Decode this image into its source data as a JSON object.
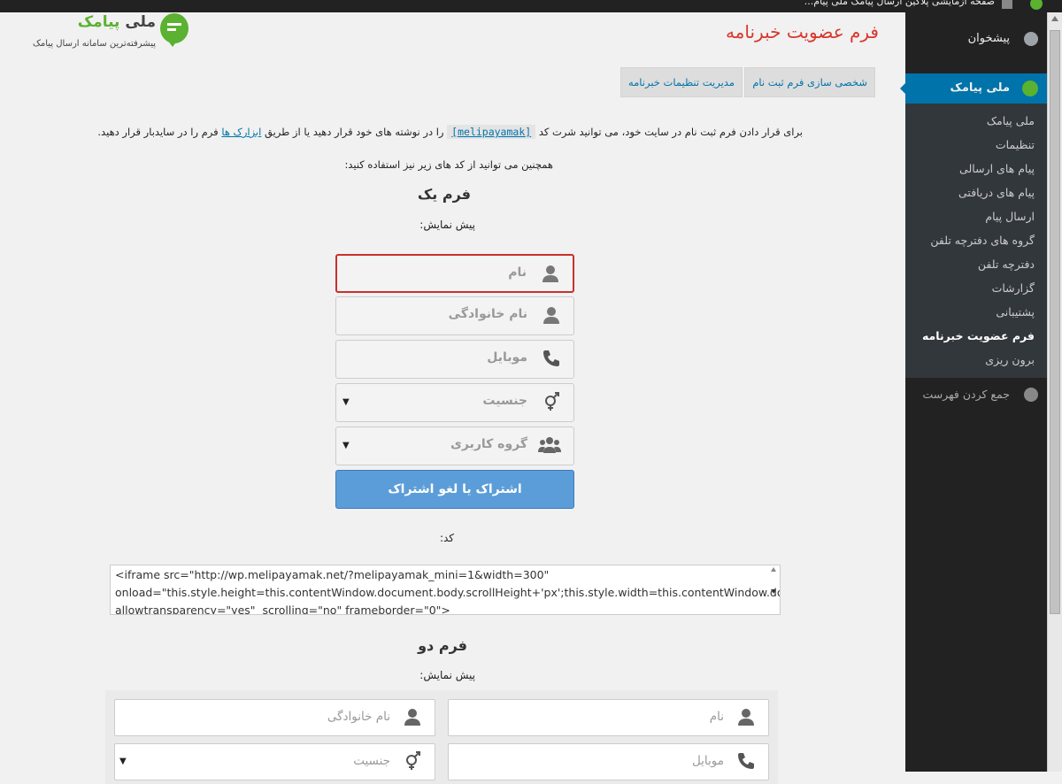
{
  "adminbar": {
    "title": "صفحه آزمایشی پلاگین ارسال پیامک ملی پیام..."
  },
  "sidebar": {
    "dashboard": "پیشخوان",
    "plugin_menu": "ملی پیامک",
    "submenu": [
      "ملی پیامک",
      "تنظیمات",
      "پیام های ارسالی",
      "پیام های دریافتی",
      "ارسال پیام",
      "گروه های دفترچه تلفن",
      "دفترچه تلفن",
      "گزارشات",
      "پشتیبانی",
      "فرم عضویت خبرنامه",
      "برون ریزی"
    ],
    "current_submenu": "فرم عضویت خبرنامه",
    "collapse": "جمع کردن فهرست"
  },
  "logo": {
    "name_green": "پیامک",
    "name_dark": "ملی",
    "tagline": "پیشرفته‌ترین سامانه ارسال پیامک"
  },
  "page": {
    "title": "فرم عضویت خبرنامه"
  },
  "tabs": [
    "شخصی سازی فرم ثبت نام",
    "مدیریت تنظیمات خبرنامه"
  ],
  "intro": {
    "part1": "برای قرار دادن فرم ثبت نام در سایت خود، می توانید شرت کد",
    "shortcode": "[melipayamak]",
    "part2": "را در نوشته های خود قرار دهید یا از طریق",
    "link": "ابزارک ها",
    "part3": "فرم را در سایدبار قرار دهید.",
    "line2": "همچنین می توانید از کد های زیر نیز استفاده کنید:"
  },
  "form1": {
    "title": "فرم یک",
    "preview_label": "پیش نمایش:",
    "fields": [
      {
        "placeholder": "نام",
        "icon": "user-icon"
      },
      {
        "placeholder": "نام خانوادگی",
        "icon": "user-icon"
      },
      {
        "placeholder": "موبایل",
        "icon": "phone-icon"
      },
      {
        "placeholder": "جنسیت",
        "icon": "gender-icon",
        "select": true
      },
      {
        "placeholder": "گروه کاربری",
        "icon": "users-group-icon",
        "select": true
      }
    ],
    "submit": "اشتراک یا لغو اشتراک"
  },
  "code": {
    "label": "کد:",
    "value": "<iframe src=\"http://wp.melipayamak.net/?melipayamak_mini=1&width=300\" onload=\"this.style.height=this.contentWindow.document.body.scrollHeight+'px';this.style.width=this.contentWindow.document.body.scrollWidth+'px';this.style.display='inline'\" allowtransparency=\"yes\"  scrolling=\"no\" frameborder=\"0\">"
  },
  "form2": {
    "title": "فرم دو",
    "preview_label": "پیش نمایش:",
    "fields": {
      "first_name": "نام",
      "last_name": "نام خانوادگی",
      "mobile": "موبایل",
      "gender": "جنسیت"
    }
  }
}
